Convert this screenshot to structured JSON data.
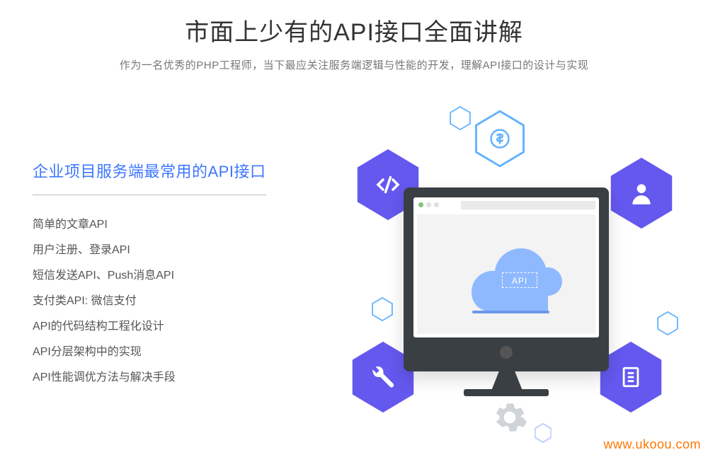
{
  "header": {
    "title": "市面上少有的API接口全面讲解",
    "subtitle": "作为一名优秀的PHP工程师，当下最应关注服务端逻辑与性能的开发，理解API接口的设计与实现"
  },
  "section": {
    "title": "企业项目服务端最常用的API接口",
    "items": [
      "简单的文章API",
      "用户注册、登录API",
      "短信发送API、Push消息API",
      "支付类API:  微信支付",
      "API的代码结构工程化设计",
      "API分层架构中的实现",
      "API性能调优方法与解决手段"
    ]
  },
  "illustration": {
    "api_label": "API"
  },
  "colors": {
    "primary_text": "#333333",
    "accent_blue": "#3d77ff",
    "hex_purple": "#6458ef",
    "hex_outline": "#62b2ff",
    "cloud": "#8fb9ff",
    "gear": "#cfd4d8",
    "watermark": "#ff7700"
  },
  "watermark": "www.ukoou.com"
}
